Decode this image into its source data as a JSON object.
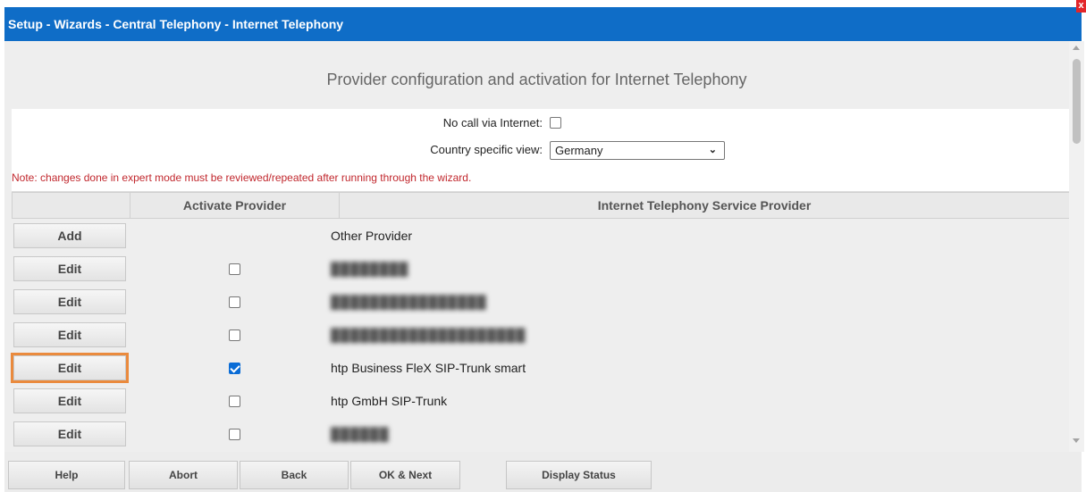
{
  "window": {
    "title": "Setup - Wizards - Central Telephony - Internet Telephony",
    "close_label": "x"
  },
  "page": {
    "heading": "Provider configuration and activation for Internet Telephony"
  },
  "settings": {
    "no_call_label": "No call via Internet:",
    "no_call_checked": false,
    "country_label": "Country specific view:",
    "country_value": "Germany",
    "note": "Note: changes done in expert mode must be reviewed/repeated after running through the wizard."
  },
  "table": {
    "headers": {
      "action": "",
      "activate": "Activate Provider",
      "provider": "Internet Telephony Service Provider"
    },
    "rows": [
      {
        "button": "Add",
        "checkbox": null,
        "name": "Other Provider",
        "blurred": false,
        "highlight": false
      },
      {
        "button": "Edit",
        "checkbox": false,
        "name": "████████",
        "blurred": true,
        "highlight": false
      },
      {
        "button": "Edit",
        "checkbox": false,
        "name": "████████████████",
        "blurred": true,
        "highlight": false
      },
      {
        "button": "Edit",
        "checkbox": false,
        "name": "████████████████████",
        "blurred": true,
        "highlight": false
      },
      {
        "button": "Edit",
        "checkbox": true,
        "name": "htp Business FleX SIP-Trunk smart",
        "blurred": false,
        "highlight": true
      },
      {
        "button": "Edit",
        "checkbox": false,
        "name": "htp GmbH SIP-Trunk",
        "blurred": false,
        "highlight": false
      },
      {
        "button": "Edit",
        "checkbox": false,
        "name": "██████",
        "blurred": true,
        "highlight": false
      }
    ]
  },
  "footer": {
    "help": "Help",
    "abort": "Abort",
    "back": "Back",
    "ok_next": "OK & Next",
    "display_status": "Display Status"
  },
  "colors": {
    "titlebar": "#0f6dc7",
    "note": "#c1272d",
    "highlight_outline": "#ea8a3d",
    "checkbox_checked": "#0a6cd6"
  }
}
